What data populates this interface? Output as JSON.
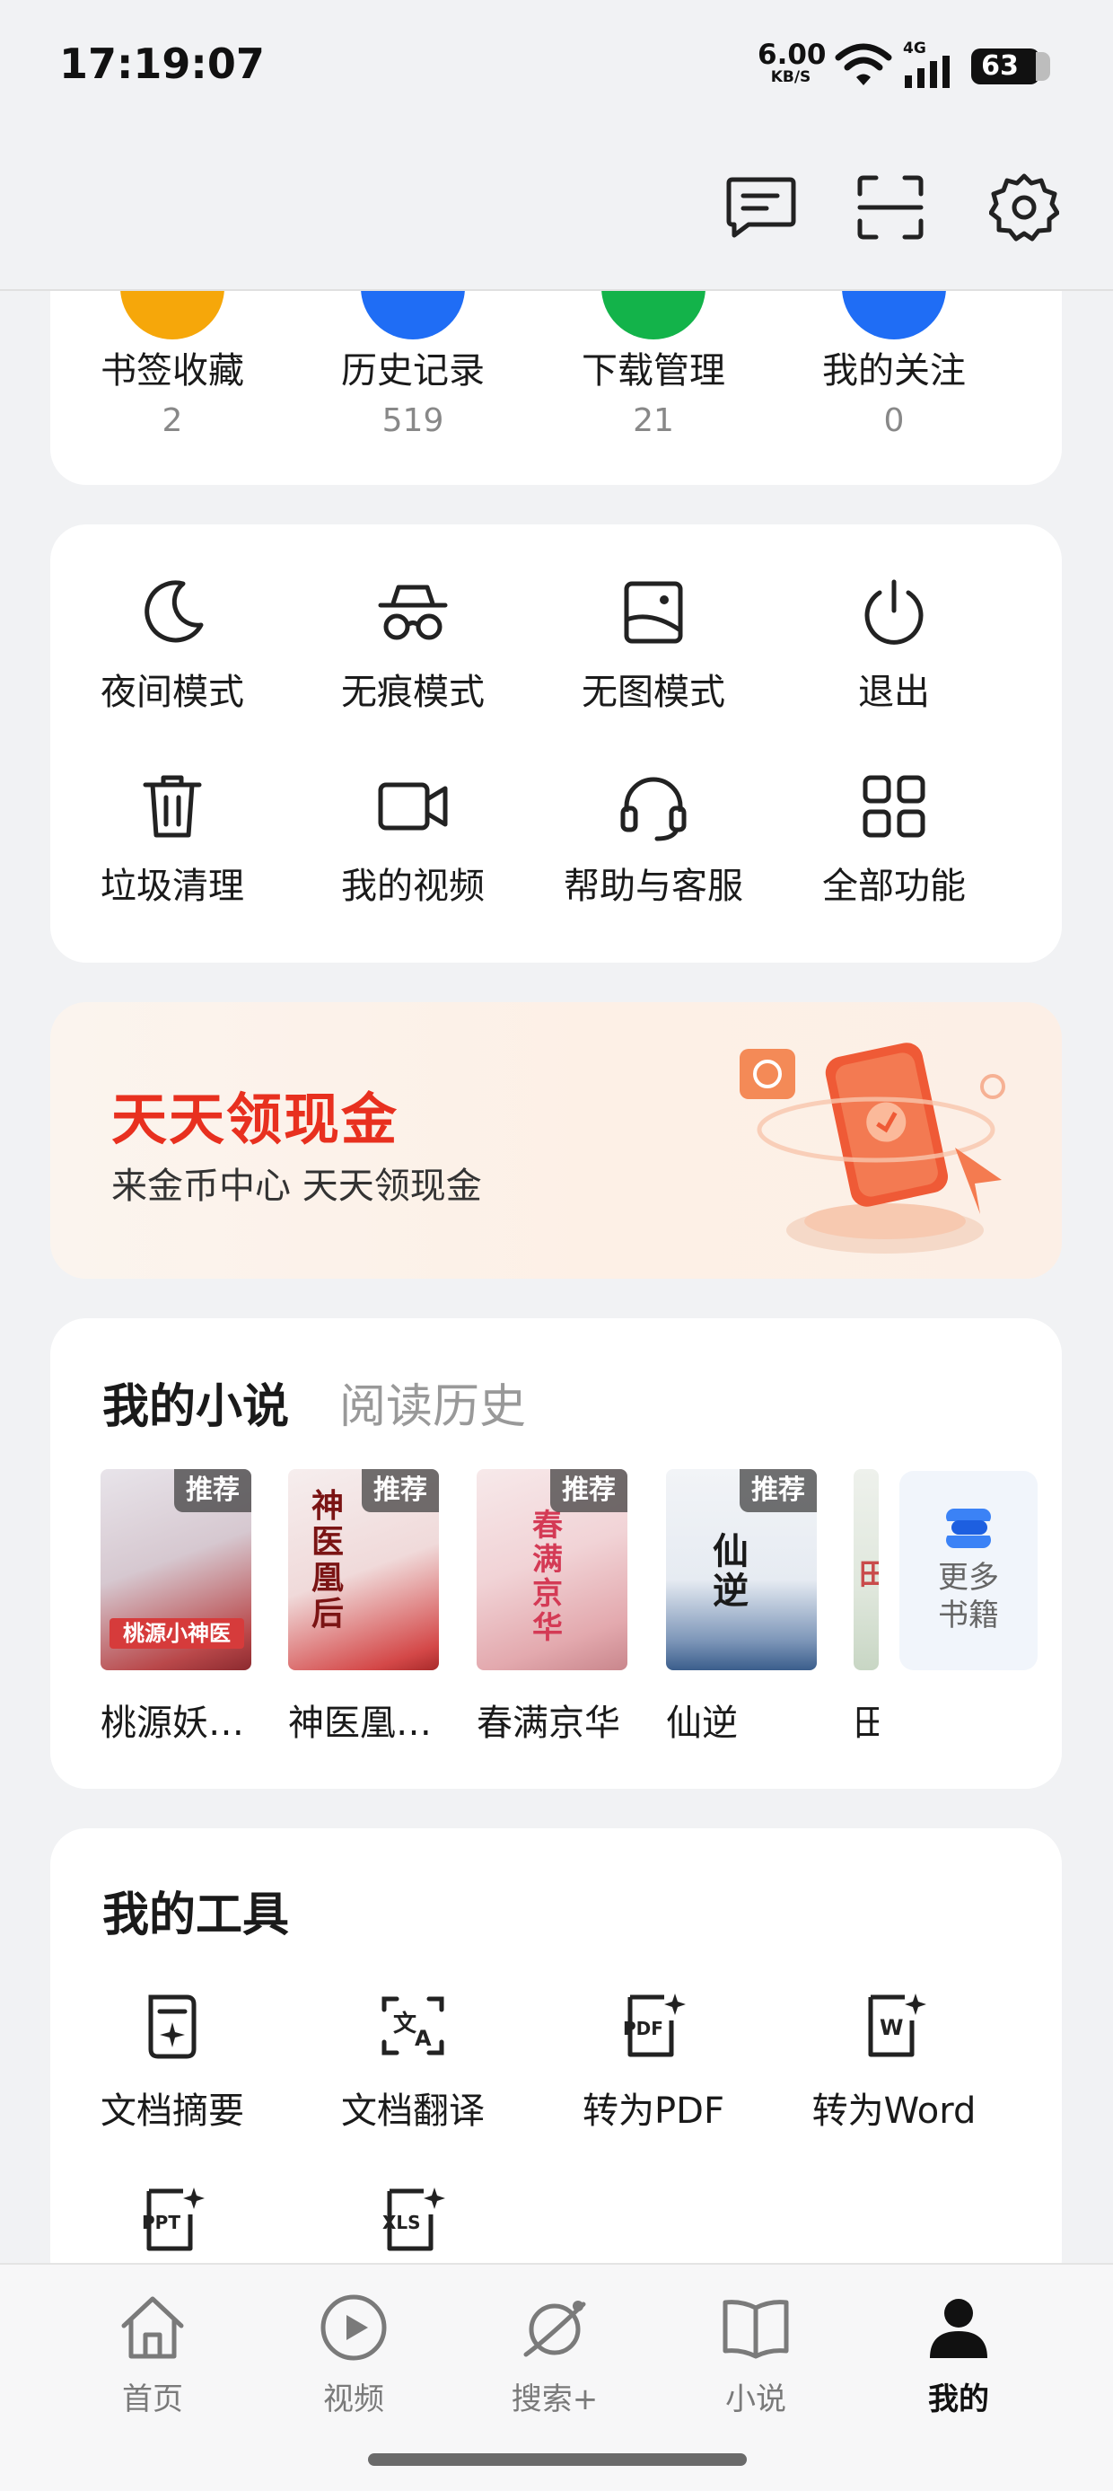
{
  "status_bar": {
    "time": "17:19:07",
    "net_speed_value": "6.00",
    "net_speed_unit": "KB/S",
    "network_type": "4G",
    "battery": "63"
  },
  "header": {
    "icons": [
      "message-icon",
      "scan-icon",
      "settings-icon"
    ]
  },
  "stats": [
    {
      "label": "书签收藏",
      "count": "2",
      "color": "#f6a70a"
    },
    {
      "label": "历史记录",
      "count": "519",
      "color": "#1f6df5"
    },
    {
      "label": "下载管理",
      "count": "21",
      "color": "#13b34a"
    },
    {
      "label": "我的关注",
      "count": "0",
      "color": "#1f6df5"
    }
  ],
  "functions": [
    {
      "label": "夜间模式",
      "icon": "moon-icon"
    },
    {
      "label": "无痕模式",
      "icon": "incognito-icon"
    },
    {
      "label": "无图模式",
      "icon": "no-image-icon"
    },
    {
      "label": "退出",
      "icon": "power-icon"
    },
    {
      "label": "垃圾清理",
      "icon": "trash-icon"
    },
    {
      "label": "我的视频",
      "icon": "video-camera-icon"
    },
    {
      "label": "帮助与客服",
      "icon": "headset-icon"
    },
    {
      "label": "全部功能",
      "icon": "grid-icon"
    }
  ],
  "banner": {
    "title": "天天领现金",
    "subtitle": "来金币中心 天天领现金"
  },
  "novels": {
    "tab_active": "我的小说",
    "tab_inactive": "阅读历史",
    "tag": "推荐",
    "books": [
      {
        "title": "桃源妖…",
        "cover_text": "桃源小神医"
      },
      {
        "title": "神医凰…",
        "cover_text": "神医凰后"
      },
      {
        "title": "春满京华",
        "cover_text": "春满京华"
      },
      {
        "title": "仙逆",
        "cover_text": "仙逆"
      },
      {
        "title": "田",
        "cover_text": "田"
      }
    ],
    "more_line1": "更多",
    "more_line2": "书籍"
  },
  "tools": {
    "title": "我的工具",
    "items": [
      {
        "label": "文档摘要",
        "icon": "doc-summary-icon"
      },
      {
        "label": "文档翻译",
        "icon": "doc-translate-icon"
      },
      {
        "label": "转为PDF",
        "icon": "pdf-icon",
        "badge": "PDF"
      },
      {
        "label": "转为Word",
        "icon": "word-icon",
        "badge": "W"
      },
      {
        "label": "",
        "icon": "ppt-icon",
        "badge": "PPT"
      },
      {
        "label": "",
        "icon": "xls-icon",
        "badge": "XLS"
      }
    ]
  },
  "bottom_nav": [
    {
      "label": "首页",
      "icon": "home-icon"
    },
    {
      "label": "视频",
      "icon": "play-icon"
    },
    {
      "label": "搜索+",
      "icon": "planet-icon"
    },
    {
      "label": "小说",
      "icon": "book-icon"
    },
    {
      "label": "我的",
      "icon": "person-icon",
      "active": true
    }
  ]
}
